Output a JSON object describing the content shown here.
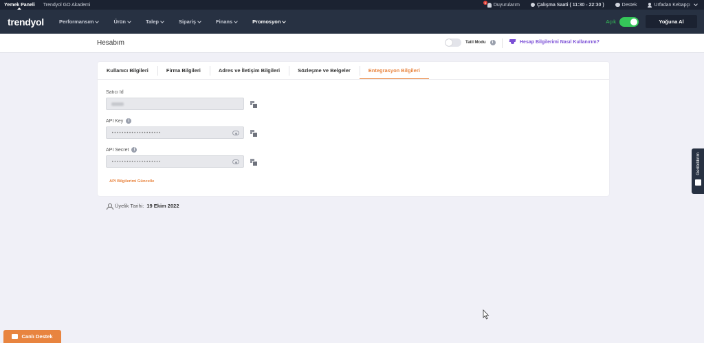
{
  "topbar": {
    "left_items": [
      "Yemek Paneli",
      "Trendyol GO Akademi"
    ],
    "notification_count": "3",
    "announcements": "Duyurularım",
    "working_hours": "Çalışma Saati ( 11:30 - 22:30 )",
    "support": "Destek",
    "store_name": "Urfadan Kebapçı"
  },
  "nav": {
    "logo": "trendyol",
    "items": [
      "Performansım",
      "Ürün",
      "Talep",
      "Sipariş",
      "Finans",
      "Promosyon"
    ],
    "status_label": "Açık",
    "busy_button": "Yoğuna Al"
  },
  "subheader": {
    "title": "Hesabım",
    "vacation_mode": "Tatil Modu",
    "help_link": "Hesap Bilgilerimi Nasıl Kullanırım?"
  },
  "tabs": [
    "Kullanıcı Bilgileri",
    "Firma Bilgileri",
    "Adres ve İletişim Bilgileri",
    "Sözleşme ve Belgeler",
    "Entegrasyon Bilgileri"
  ],
  "active_tab": "Entegrasyon Bilgileri",
  "fields": {
    "seller_id_label": "Satıcı Id",
    "api_key_label": "API Key",
    "api_key_value": "••••••••••••••••••••",
    "api_secret_label": "API Secret",
    "api_secret_value": "••••••••••••••••••••"
  },
  "update_link": "API Bilgilerimi Güncelle",
  "membership": {
    "label": "Üyelik Tarihi:",
    "date": "19 Ekim 2022"
  },
  "feedback": "Geribildirim",
  "live_support": "Canlı Destek",
  "colors": {
    "accent": "#e8843f",
    "nav_bg": "#273142",
    "toggle_on": "#35c759",
    "help_link": "#7b4fd6"
  }
}
